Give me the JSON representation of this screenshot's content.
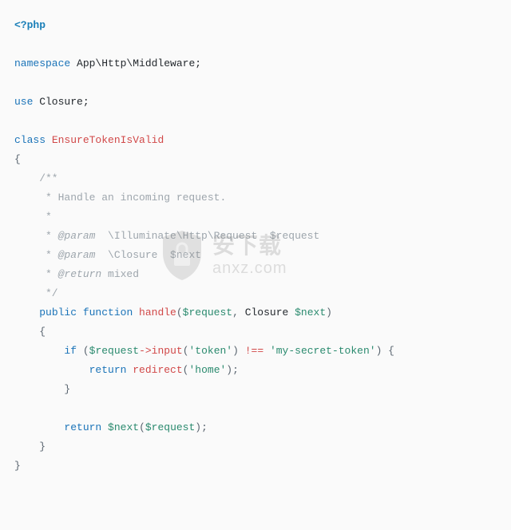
{
  "code": {
    "php_open": "<?php",
    "ns_kw": "namespace",
    "ns_path": " App\\Http\\Middleware;",
    "use_kw": "use",
    "use_target": " Closure;",
    "class_kw": "class",
    "class_name": " EnsureTokenIsValid",
    "brace_open": "{",
    "doc_open": "    /**",
    "doc_l1": "     * Handle an incoming request.",
    "doc_l2": "     *",
    "doc_l3_star": "     * ",
    "doc_l3_param": "@param",
    "doc_l3_rest": "  \\Illuminate\\Http\\Request  $request",
    "doc_l4_star": "     * ",
    "doc_l4_param": "@param",
    "doc_l4_rest": "  \\Closure  $next",
    "doc_l5_star": "     * ",
    "doc_l5_ret": "@return",
    "doc_l5_rest": " mixed",
    "doc_close": "     */",
    "fn_indent": "    ",
    "fn_public": "public",
    "fn_function": " function",
    "fn_name": " handle",
    "fn_paren_open": "(",
    "fn_arg1": "$request",
    "fn_comma": ", ",
    "fn_arg2_type": "Closure ",
    "fn_arg2": "$next",
    "fn_paren_close": ")",
    "fn_brace_open": "    {",
    "if_indent": "        ",
    "if_kw": "if",
    "if_po": " (",
    "if_var": "$request",
    "if_arrow": "->",
    "if_method": "input",
    "if_mpo": "(",
    "if_token_str": "'token'",
    "if_mpc": ")",
    "if_neq": " !== ",
    "if_secret": "'my-secret-token'",
    "if_pc": ") {",
    "ret1_indent": "            ",
    "ret1_kw": "return",
    "ret1_sp": " ",
    "ret1_fn": "redirect",
    "ret1_po": "(",
    "ret1_str": "'home'",
    "ret1_pc": ");",
    "if_close": "        }",
    "ret2_indent": "        ",
    "ret2_kw": "return",
    "ret2_sp": " ",
    "ret2_var": "$next",
    "ret2_po": "(",
    "ret2_arg": "$request",
    "ret2_pc": ");",
    "fn_brace_close": "    }",
    "brace_close": "}"
  },
  "watermark": {
    "name_cn": "安下载",
    "domain": "anxz.com"
  }
}
